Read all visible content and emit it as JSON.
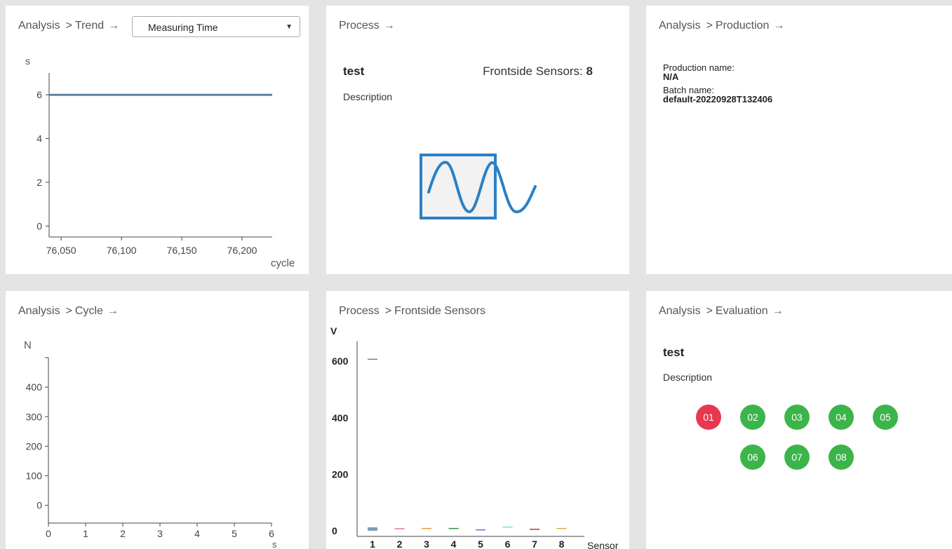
{
  "colors": {
    "ok": "#3bb54a",
    "fail": "#e8384f",
    "trend_line": "#5b84a6",
    "icon": "#2b80c5"
  },
  "trend": {
    "crumb_root": "Analysis",
    "crumb_page": "Trend",
    "dropdown_value": "Measuring Time",
    "y_unit": "s",
    "x_unit": "cycle"
  },
  "process": {
    "crumb_root": "Process",
    "title": "test",
    "sensors_label": "Frontside Sensors:",
    "sensors_count": "8",
    "description": "Description"
  },
  "production": {
    "crumb_root": "Analysis",
    "crumb_page": "Production",
    "production_label": "Production name:",
    "production_value": "N/A",
    "batch_label": "Batch name:",
    "batch_value": "default-20220928T132406"
  },
  "cycle": {
    "crumb_root": "Analysis",
    "crumb_page": "Cycle",
    "y_unit": "N",
    "x_unit": "s"
  },
  "sensors": {
    "crumb_root": "Process",
    "crumb_page": "Frontside Sensors",
    "y_unit": "V",
    "x_unit": "Sensor"
  },
  "evaluation": {
    "crumb_root": "Analysis",
    "crumb_page": "Evaluation",
    "title": "test",
    "description": "Description",
    "results": [
      {
        "label": "01",
        "status": "fail"
      },
      {
        "label": "02",
        "status": "ok"
      },
      {
        "label": "03",
        "status": "ok"
      },
      {
        "label": "04",
        "status": "ok"
      },
      {
        "label": "05",
        "status": "ok"
      },
      {
        "label": "06",
        "status": "ok"
      },
      {
        "label": "07",
        "status": "ok"
      },
      {
        "label": "08",
        "status": "ok"
      }
    ]
  },
  "chart_data": [
    {
      "type": "line",
      "ylabel": "s",
      "xlabel": "cycle",
      "x_ticks": [
        "76,050",
        "76,100",
        "76,150",
        "76,200"
      ],
      "y_ticks": [
        "0",
        "2",
        "4",
        "6"
      ],
      "xlim": [
        76040,
        76225
      ],
      "ylim": [
        -0.5,
        7
      ],
      "series": [
        {
          "x": [
            76040,
            76225
          ],
          "y": [
            6,
            6
          ]
        }
      ]
    },
    {
      "type": "scatter",
      "ylabel": "N",
      "xlabel": "s",
      "x_ticks": [
        "0",
        "1",
        "2",
        "3",
        "4",
        "5",
        "6"
      ],
      "y_ticks": [
        "0",
        "100",
        "200",
        "300",
        "400"
      ],
      "xlim": [
        0,
        6
      ],
      "ylim": [
        -60,
        500
      ],
      "series": []
    },
    {
      "type": "bar",
      "ylabel": "V",
      "xlabel": "Sensor",
      "categories": [
        "1",
        "2",
        "3",
        "4",
        "5",
        "6",
        "7",
        "8"
      ],
      "y_ticks": [
        "0",
        "200",
        "400",
        "600"
      ],
      "ylim": [
        -20,
        670
      ],
      "values": [
        12,
        0,
        0,
        0,
        0,
        0,
        0,
        0
      ],
      "max_markers": [
        607,
        7,
        8,
        8,
        3,
        13,
        5,
        8
      ],
      "marker_colors": [
        "#5b84a6",
        "#e6739f",
        "#e89a3a",
        "#3a8f4c",
        "#9b59d0",
        "#7fdcc8",
        "#c0392b",
        "#d4b04a"
      ]
    }
  ]
}
